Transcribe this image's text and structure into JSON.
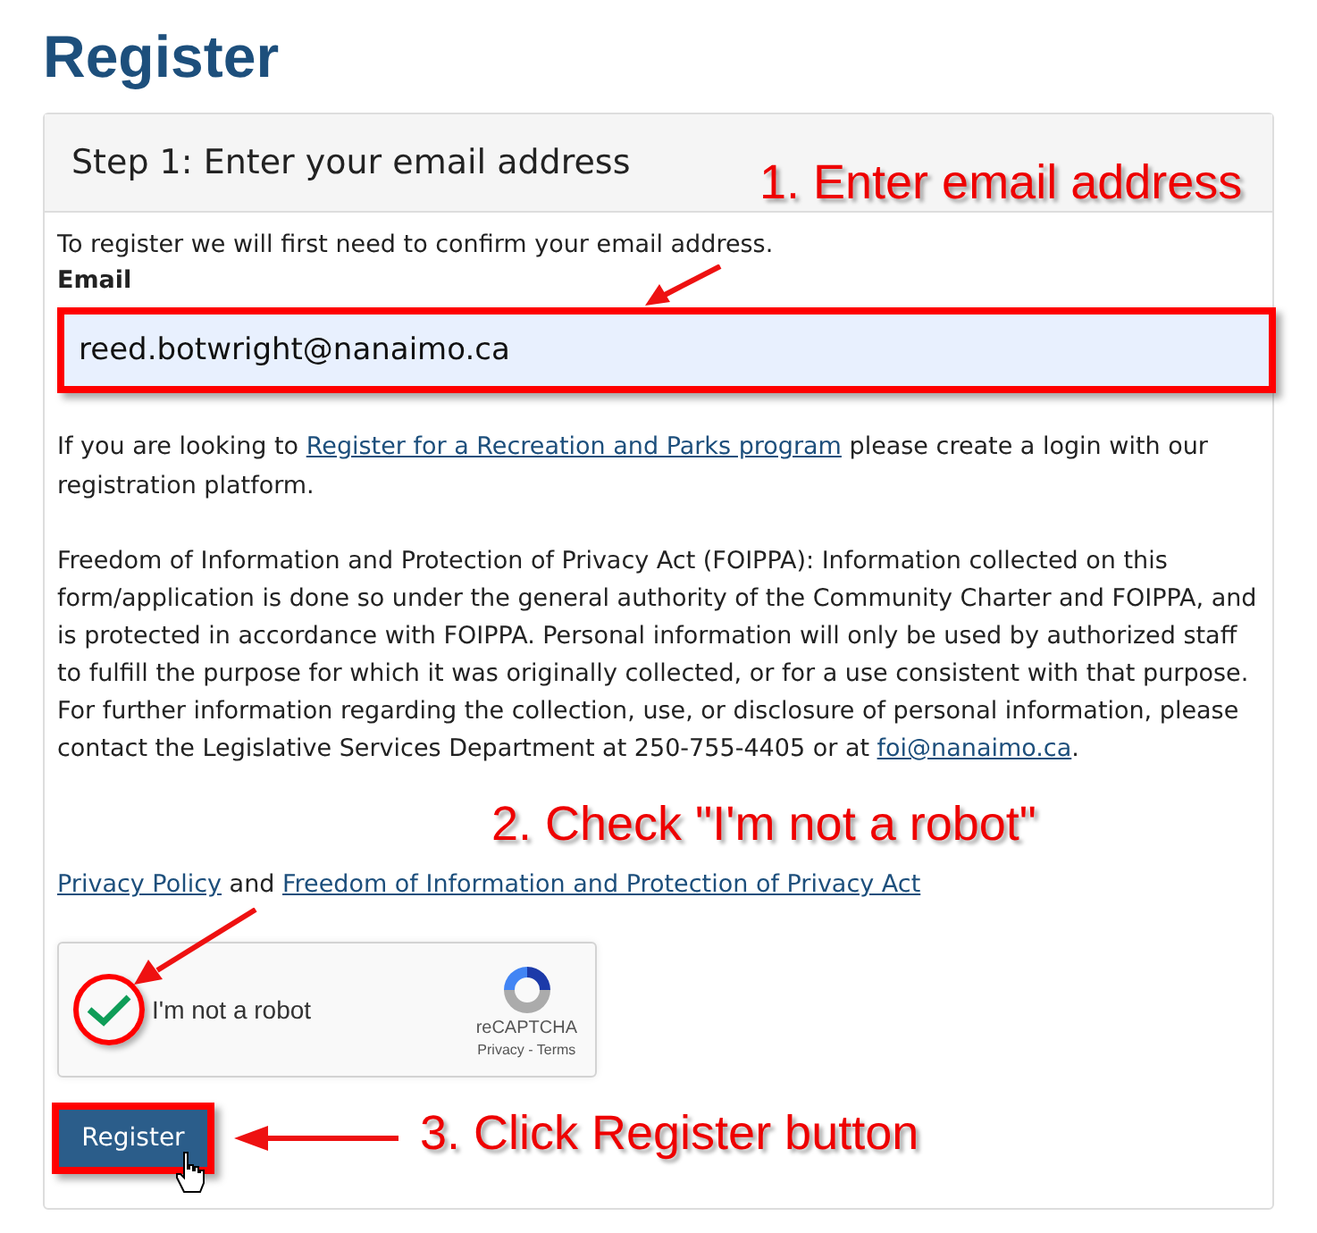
{
  "title": "Register",
  "panel": {
    "heading": "Step 1: Enter your email address",
    "intro": "To register we will first need to confirm your email address.",
    "email": {
      "label": "Email",
      "value": "reed.botwright@nanaimo.ca"
    },
    "paragraphs": [
      {
        "parts": [
          {
            "kind": "text",
            "text": "If you are looking to "
          },
          {
            "kind": "link",
            "text": "Register for a Recreation and Parks program"
          },
          {
            "kind": "text",
            "text": " please create a login with our registration platform."
          }
        ]
      },
      {
        "parts": [
          {
            "kind": "text",
            "text": "Freedom of Information and Protection of Privacy Act (FOIPPA): Information collected on this form/application is done so under the general authority of the Community Charter and FOIPPA, and is protected in accordance with FOIPPA. Personal information will only be used by authorized staff to fulfill the purpose for which it was originally collected, or for a use consistent with that purpose. For further information regarding the collection, use, or disclosure of personal information, please contact the Legislative Services Department at 250-755-4405 or at "
          },
          {
            "kind": "link",
            "text": "foi@nanaimo.ca"
          },
          {
            "kind": "text",
            "text": "."
          }
        ]
      },
      {
        "parts": [
          {
            "kind": "link",
            "text": "Privacy Policy"
          },
          {
            "kind": "text",
            "text": " and "
          },
          {
            "kind": "link",
            "text": "Freedom of Information and Protection of Privacy Act"
          }
        ]
      }
    ],
    "captcha": {
      "checked": true,
      "label": "I'm not a robot",
      "brand": "reCAPTCHA",
      "links": "Privacy - Terms"
    },
    "button": "Register"
  },
  "callouts": [
    {
      "text": "1. Enter email address"
    },
    {
      "text": "2. Check \"I'm not a robot\""
    },
    {
      "text": "3. Click Register button"
    }
  ]
}
